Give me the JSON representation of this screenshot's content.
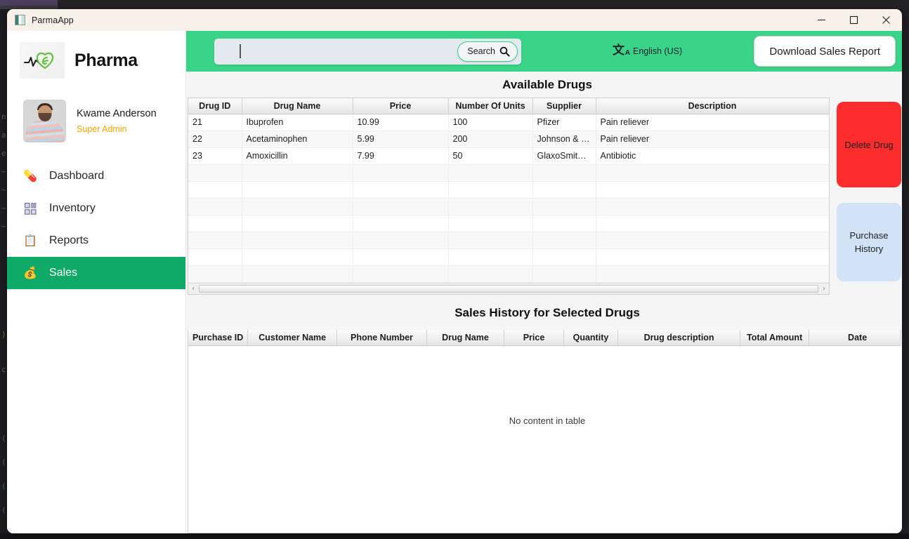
{
  "window": {
    "title": "ParmaApp",
    "app_icon": "app-tile-icon",
    "controls": {
      "minimize": "minimize-icon",
      "maximize": "maximize-icon",
      "close": "close-icon"
    }
  },
  "sidebar": {
    "brand": {
      "name": "Pharma",
      "logo": "heart-ecg-logo"
    },
    "profile": {
      "name": "Kwame Anderson",
      "role": "Super Admin",
      "avatar": "user-avatar"
    },
    "nav": [
      {
        "label": "Dashboard",
        "icon": "pill-icon",
        "active": false
      },
      {
        "label": "Inventory",
        "icon": "blocks-icon",
        "active": false
      },
      {
        "label": "Reports",
        "icon": "clipboard-icon",
        "active": false
      },
      {
        "label": "Sales",
        "icon": "money-bag-icon",
        "active": true
      }
    ]
  },
  "topbar": {
    "search": {
      "value": "",
      "placeholder": "",
      "button_label": "Search",
      "button_icon": "search-icon"
    },
    "language": {
      "label": "English (US)",
      "icon": "translate-icon",
      "glyph": "文",
      "sub": "A"
    },
    "download_label": "Download Sales Report"
  },
  "drugs": {
    "title": "Available Drugs",
    "columns": [
      "Drug ID",
      "Drug Name",
      "Price",
      "Number Of Units",
      "Supplier",
      "Description"
    ],
    "rows": [
      [
        "21",
        "Ibuprofen",
        "10.99",
        "100",
        "Pfizer",
        "Pain reliever"
      ],
      [
        "22",
        "Acetaminophen",
        "5.99",
        "200",
        "Johnson & Jo...",
        "Pain reliever"
      ],
      [
        "23",
        "Amoxicillin",
        "7.99",
        "50",
        "GlaxoSmithKli...",
        "Antibiotic"
      ]
    ],
    "empty_row_count": 8,
    "actions": {
      "delete_label": "Delete Drug",
      "delete_color": "#fd2d2d",
      "purchase_history_label": "Purchase\nHistory",
      "purchase_history_line1": "Purchase",
      "purchase_history_line2": "History",
      "purchase_history_color": "#d2e3f8"
    },
    "scrollbar": {
      "left_arrow": "‹",
      "right_arrow": "›"
    }
  },
  "sales": {
    "title": "Sales History for Selected Drugs",
    "columns": [
      "Purchase ID",
      "Customer Name",
      "Phone Number",
      "Drug Name",
      "Price",
      "Quantity",
      "Drug description",
      "Total Amount",
      "Date"
    ],
    "rows": [],
    "empty_message": "No content in table"
  },
  "theme": {
    "accent_green": "#3ad488",
    "active_green": "#0fa968",
    "role_amber": "#f0a500",
    "titlebar_bg": "#f7f1ea"
  }
}
